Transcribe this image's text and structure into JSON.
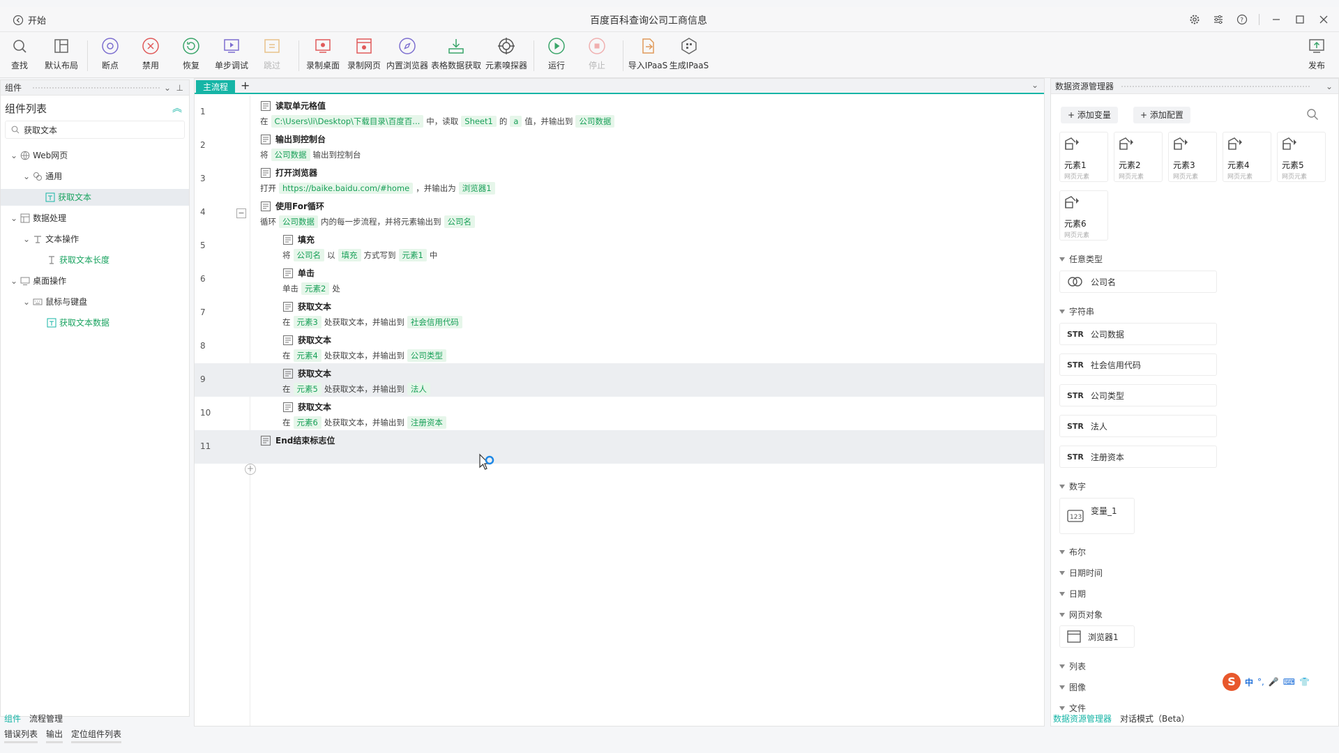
{
  "title": {
    "back_label": "开始",
    "window_title": "百度百科查询公司工商信息"
  },
  "toolbar": {
    "find": "查找",
    "layout": "默认布局",
    "breakpoint": "断点",
    "disable": "禁用",
    "restore": "恢复",
    "step_debug": "单步调试",
    "skip": "跳过",
    "record_desktop": "录制桌面",
    "record_web": "录制网页",
    "builtin_browser": "内置浏览器",
    "table_fetch": "表格数据获取",
    "element_picker": "元素嗅探器",
    "run": "运行",
    "stop": "停止",
    "import_ipaas": "导入IPaaS",
    "gen_ipaas": "生成IPaaS",
    "publish": "发布"
  },
  "left": {
    "header": "组件",
    "list_title": "组件列表",
    "search_value": "获取文本",
    "tree": [
      "Web网页",
      "通用",
      "获取文本",
      "数据处理",
      "文本操作",
      "获取文本长度",
      "桌面操作",
      "鼠标与键盘",
      "获取文本数据"
    ],
    "tabs": [
      "组件",
      "流程管理"
    ]
  },
  "canvas": {
    "tab": "主流程",
    "add": "+",
    "steps": [
      {
        "n": "1",
        "title": "读取单元格值",
        "d": [
          "在",
          "C:\\Users\\li\\Desktop\\下载目录\\百度百...",
          "中，读取",
          "Sheet1",
          "的",
          "a",
          "值，并输出到",
          "公司数据"
        ]
      },
      {
        "n": "2",
        "title": "输出到控制台",
        "d": [
          "将",
          "公司数据",
          "输出到控制台"
        ]
      },
      {
        "n": "3",
        "title": "打开浏览器",
        "d": [
          "打开",
          "https://baike.baidu.com/#home",
          "，并输出为",
          "浏览器1"
        ]
      },
      {
        "n": "4",
        "title": "使用For循环",
        "d": [
          "循环",
          "公司数据",
          "内的每一步流程，并将元素输出到",
          "公司名"
        ]
      },
      {
        "n": "5",
        "title": "填充",
        "d": [
          "将",
          "公司名",
          "以",
          "填充",
          "方式写到",
          "元素1",
          "中"
        ]
      },
      {
        "n": "6",
        "title": "单击",
        "d": [
          "单击",
          "元素2",
          "处"
        ]
      },
      {
        "n": "7",
        "title": "获取文本",
        "d": [
          "在",
          "元素3",
          "处获取文本，并输出到",
          "社会信用代码"
        ]
      },
      {
        "n": "8",
        "title": "获取文本",
        "d": [
          "在",
          "元素4",
          "处获取文本，并输出到",
          "公司类型"
        ]
      },
      {
        "n": "9",
        "title": "获取文本",
        "d": [
          "在",
          "元素5",
          "处获取文本，并输出到",
          "法人"
        ]
      },
      {
        "n": "10",
        "title": "获取文本",
        "d": [
          "在",
          "元素6",
          "处获取文本，并输出到",
          "注册资本"
        ]
      },
      {
        "n": "11",
        "title": "End结束标志位",
        "d": []
      }
    ]
  },
  "right": {
    "header": "数据资源管理器",
    "add_var": "添加变量",
    "add_config": "添加配置",
    "elements": [
      {
        "name": "元素1",
        "sub": "网页元素"
      },
      {
        "name": "元素2",
        "sub": "网页元素"
      },
      {
        "name": "元素3",
        "sub": "网页元素"
      },
      {
        "name": "元素4",
        "sub": "网页元素"
      },
      {
        "name": "元素5",
        "sub": "网页元素"
      },
      {
        "name": "元素6",
        "sub": "网页元素"
      }
    ],
    "sec_any": "任意类型",
    "any_var": "公司名",
    "sec_str": "字符串",
    "str_prefix": "STR",
    "str_vars": [
      "公司数据",
      "社会信用代码",
      "公司类型",
      "法人",
      "注册资本"
    ],
    "sec_num": "数字",
    "num_var": "变量_1",
    "sec_bool": "布尔",
    "sec_datetime": "日期时间",
    "sec_date": "日期",
    "sec_web": "网页对象",
    "web_var": "浏览器1",
    "sec_list": "列表",
    "sec_image": "图像",
    "sec_file": "文件",
    "tabs": [
      "数据资源管理器",
      "对话模式（Beta）"
    ]
  },
  "bottom": {
    "tabs": [
      "错误列表",
      "输出",
      "定位组件列表"
    ]
  },
  "ime": {
    "lang": "中"
  },
  "colors": {
    "accent": "#16b5a6",
    "tag_bg": "#e6f6ea",
    "tag_fg": "#18a058"
  }
}
